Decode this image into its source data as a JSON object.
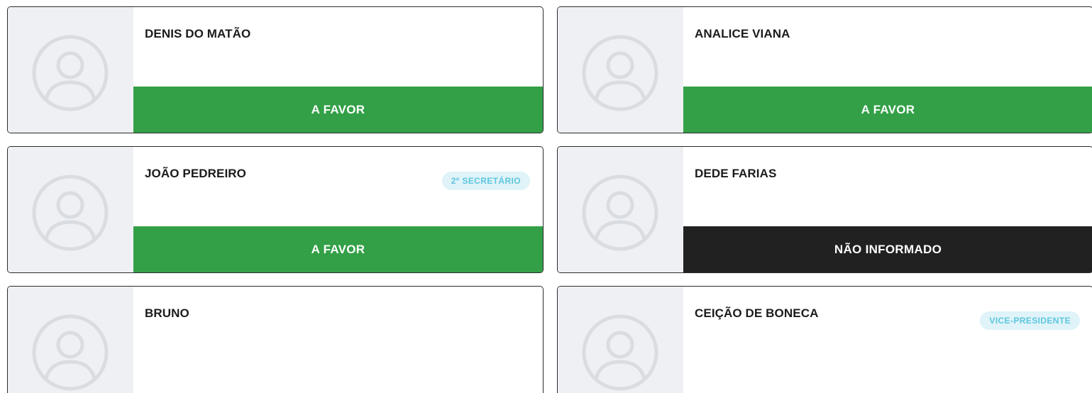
{
  "colors": {
    "favor": "#33a047",
    "not_informed": "#212121",
    "badge_bg": "#dff3f8",
    "badge_text": "#5cc6df",
    "photo_bg": "#eef0f3"
  },
  "members": [
    {
      "name": "DENIS DO MATÃO",
      "role": "",
      "vote": "A FAVOR",
      "photo_icon": "user-placeholder-icon"
    },
    {
      "name": "ANALICE VIANA",
      "role": "",
      "vote": "A FAVOR",
      "photo_icon": "user-placeholder-icon"
    },
    {
      "name": "JOÃO PEDREIRO",
      "role": "2º SECRETÁRIO",
      "vote": "A FAVOR",
      "photo_icon": "user-placeholder-icon"
    },
    {
      "name": "DEDE FARIAS",
      "role": "",
      "vote": "NÃO INFORMADO",
      "photo_icon": "user-placeholder-icon"
    },
    {
      "name": "BRUNO",
      "role": "",
      "vote": "",
      "photo_icon": "user-placeholder-icon"
    },
    {
      "name": "CEIÇÃO DE BONECA",
      "role": "VICE-PRESIDENTE",
      "vote": "",
      "photo_icon": "user-placeholder-icon"
    }
  ]
}
